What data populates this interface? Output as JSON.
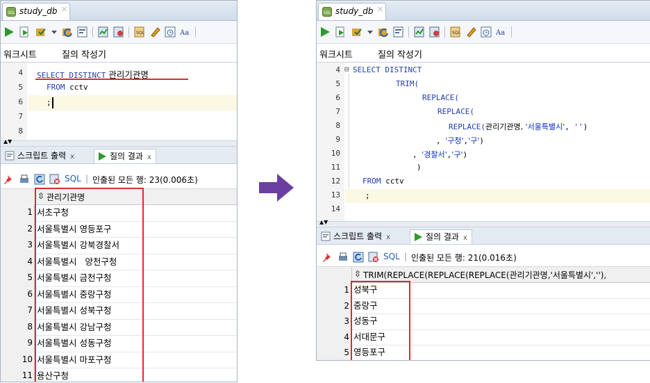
{
  "colors": {
    "accent_red": "#e02a2a",
    "arrow": "#6b3fa0",
    "keyword": "#1f3fa8",
    "string": "#0b2fc8"
  },
  "left": {
    "tab_title": "study_db",
    "tab_icon": "database-connection-icon",
    "tab_icon_text": "SQL",
    "worksheet_tab": "워크시트",
    "query_builder_tab": "질의 작성기",
    "editor": {
      "line_numbers": [
        "4",
        "5",
        "6",
        "7",
        "8"
      ],
      "line4": {
        "kw": "SELECT DISTINCT",
        "col": " 관리기관명"
      },
      "line5": {
        "kw": "FROM",
        "rest": " cctv"
      },
      "line6": ";"
    },
    "result_tabs": {
      "script_output": "스크립트 출력",
      "query_result": "질의 결과",
      "close": "x"
    },
    "result_toolbar": {
      "sql_link": "SQL",
      "status": "인출된 모든 행: 23(0.006초)"
    },
    "grid": {
      "column_header": "관리기관명",
      "rows": [
        {
          "n": "1",
          "v": "서초구청"
        },
        {
          "n": "2",
          "v": "서울특별시 영등포구"
        },
        {
          "n": "3",
          "v": "서울특별시 강북경찰서"
        },
        {
          "n": "4",
          "v": "서울특별시   양천구청"
        },
        {
          "n": "5",
          "v": "서울특별시 금천구청"
        },
        {
          "n": "6",
          "v": "서울특별시 중랑구청"
        },
        {
          "n": "7",
          "v": "서울특별시 성북구청"
        },
        {
          "n": "8",
          "v": "서울특별시 강남구청"
        },
        {
          "n": "9",
          "v": "서울특별시 성동구청"
        },
        {
          "n": "10",
          "v": "서울특별시 마포구청"
        },
        {
          "n": "11",
          "v": "용산구청"
        }
      ]
    }
  },
  "right": {
    "tab_title": "study_db",
    "tab_icon_text": "SQL",
    "worksheet_tab": "워크시트",
    "query_builder_tab": "질의 작성기",
    "editor": {
      "line_numbers": [
        "4",
        "5",
        "6",
        "7",
        "8",
        "9",
        "10",
        "11",
        "12",
        "13",
        "14"
      ],
      "fold_marker": "⊟",
      "l4": "SELECT DISTINCT",
      "l5": "TRIM(",
      "l6": "REPLACE(",
      "l7": "REPLACE(",
      "l8a": "REPLACE(",
      "l8b": "관리기관명, ",
      "l8c": "'서울특별시'",
      "l8d": ", ",
      "l8e": "''",
      "l8f": ")",
      "l9a": ", ",
      "l9b": "'구청'",
      "l9c": ",",
      "l9d": "'구'",
      "l9e": ")",
      "l10a": ", ",
      "l10b": "'경찰서'",
      "l10c": ",",
      "l10d": "'구'",
      "l10e": ")",
      "l11": ")",
      "l12kw": "FROM",
      "l12rest": " cctv",
      "l13": ";"
    },
    "result_tabs": {
      "script_output": "스크립트 출력",
      "query_result": "질의 결과",
      "close": "x"
    },
    "result_toolbar": {
      "sql_link": "SQL",
      "status": "인출된 모든 행: 21(0.016초)"
    },
    "grid": {
      "column_header": "TRIM(REPLACE(REPLACE(REPLACE(관리기관명,'서울특별시',''),",
      "rows": [
        {
          "n": "1",
          "v": "성북구"
        },
        {
          "n": "2",
          "v": "중랑구"
        },
        {
          "n": "3",
          "v": "성동구"
        },
        {
          "n": "4",
          "v": "서대문구"
        },
        {
          "n": "5",
          "v": "영등포구"
        }
      ]
    }
  }
}
